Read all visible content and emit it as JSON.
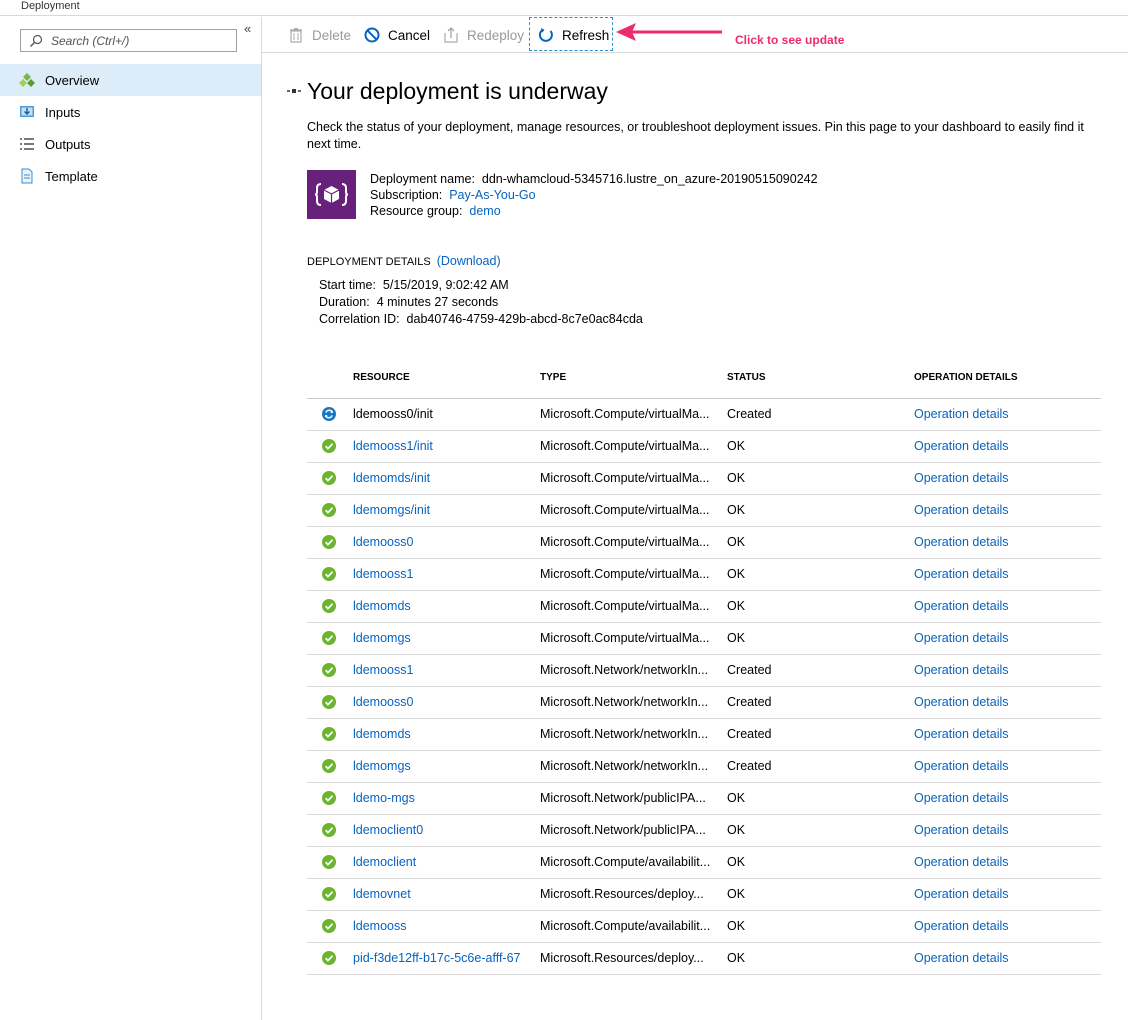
{
  "window": {
    "title": "Deployment"
  },
  "sidebar": {
    "search_placeholder": "Search (Ctrl+/)",
    "collapse_glyph": "«",
    "items": [
      {
        "label": "Overview",
        "icon": "overview-icon",
        "active": true
      },
      {
        "label": "Inputs",
        "icon": "inputs-icon",
        "active": false
      },
      {
        "label": "Outputs",
        "icon": "outputs-icon",
        "active": false
      },
      {
        "label": "Template",
        "icon": "template-icon",
        "active": false
      }
    ]
  },
  "toolbar": {
    "delete_label": "Delete",
    "cancel_label": "Cancel",
    "redeploy_label": "Redeploy",
    "refresh_label": "Refresh",
    "annotation": "Click to see update",
    "annotation_color": "#ee2b6c"
  },
  "main": {
    "title": "Your deployment is underway",
    "description": "Check the status of your deployment, manage resources, or troubleshoot deployment issues. Pin this page to your dashboard to easily find it next time.",
    "deployment_name_label": "Deployment name:",
    "deployment_name": "ddn-whamcloud-5345716.lustre_on_azure-20190515090242",
    "subscription_label": "Subscription:",
    "subscription": "Pay-As-You-Go",
    "resource_group_label": "Resource group:",
    "resource_group": "demo",
    "details_heading": "DEPLOYMENT DETAILS",
    "download_label": "(Download)",
    "start_time_label": "Start time:",
    "start_time": "5/15/2019, 9:02:42 AM",
    "duration_label": "Duration:",
    "duration": "4 minutes 27 seconds",
    "correlation_label": "Correlation ID:",
    "correlation_id": "dab40746-4759-429b-abcd-8c7e0ac84cda"
  },
  "table": {
    "headers": {
      "resource": "RESOURCE",
      "type": "TYPE",
      "status": "STATUS",
      "operation": "OPERATION DETAILS"
    },
    "rows": [
      {
        "state": "in-progress",
        "resource": "ldemooss0/init",
        "type": "Microsoft.Compute/virtualMa...",
        "status": "Created",
        "operation": "Operation details"
      },
      {
        "state": "success",
        "resource": "ldemooss1/init",
        "type": "Microsoft.Compute/virtualMa...",
        "status": "OK",
        "operation": "Operation details"
      },
      {
        "state": "success",
        "resource": "ldemomds/init",
        "type": "Microsoft.Compute/virtualMa...",
        "status": "OK",
        "operation": "Operation details"
      },
      {
        "state": "success",
        "resource": "ldemomgs/init",
        "type": "Microsoft.Compute/virtualMa...",
        "status": "OK",
        "operation": "Operation details"
      },
      {
        "state": "success",
        "resource": "ldemooss0",
        "type": "Microsoft.Compute/virtualMa...",
        "status": "OK",
        "operation": "Operation details"
      },
      {
        "state": "success",
        "resource": "ldemooss1",
        "type": "Microsoft.Compute/virtualMa...",
        "status": "OK",
        "operation": "Operation details"
      },
      {
        "state": "success",
        "resource": "ldemomds",
        "type": "Microsoft.Compute/virtualMa...",
        "status": "OK",
        "operation": "Operation details"
      },
      {
        "state": "success",
        "resource": "ldemomgs",
        "type": "Microsoft.Compute/virtualMa...",
        "status": "OK",
        "operation": "Operation details"
      },
      {
        "state": "success",
        "resource": "ldemooss1",
        "type": "Microsoft.Network/networkIn...",
        "status": "Created",
        "operation": "Operation details"
      },
      {
        "state": "success",
        "resource": "ldemooss0",
        "type": "Microsoft.Network/networkIn...",
        "status": "Created",
        "operation": "Operation details"
      },
      {
        "state": "success",
        "resource": "ldemomds",
        "type": "Microsoft.Network/networkIn...",
        "status": "Created",
        "operation": "Operation details"
      },
      {
        "state": "success",
        "resource": "ldemomgs",
        "type": "Microsoft.Network/networkIn...",
        "status": "Created",
        "operation": "Operation details"
      },
      {
        "state": "success",
        "resource": "ldemo-mgs",
        "type": "Microsoft.Network/publicIPA...",
        "status": "OK",
        "operation": "Operation details"
      },
      {
        "state": "success",
        "resource": "ldemoclient0",
        "type": "Microsoft.Network/publicIPA...",
        "status": "OK",
        "operation": "Operation details"
      },
      {
        "state": "success",
        "resource": "ldemoclient",
        "type": "Microsoft.Compute/availabilit...",
        "status": "OK",
        "operation": "Operation details"
      },
      {
        "state": "success",
        "resource": "ldemovnet",
        "type": "Microsoft.Resources/deploy...",
        "status": "OK",
        "operation": "Operation details"
      },
      {
        "state": "success",
        "resource": "ldemooss",
        "type": "Microsoft.Compute/availabilit...",
        "status": "OK",
        "operation": "Operation details"
      },
      {
        "state": "success",
        "resource": "pid-f3de12ff-b17c-5c6e-afff-67",
        "type": "Microsoft.Resources/deploy...",
        "status": "OK",
        "operation": "Operation details"
      }
    ]
  },
  "colors": {
    "link": "#0563c1",
    "success": "#6bb42e",
    "in_progress": "#1a75c4",
    "badge": "#68217a",
    "active_nav": "#dcedf9"
  }
}
